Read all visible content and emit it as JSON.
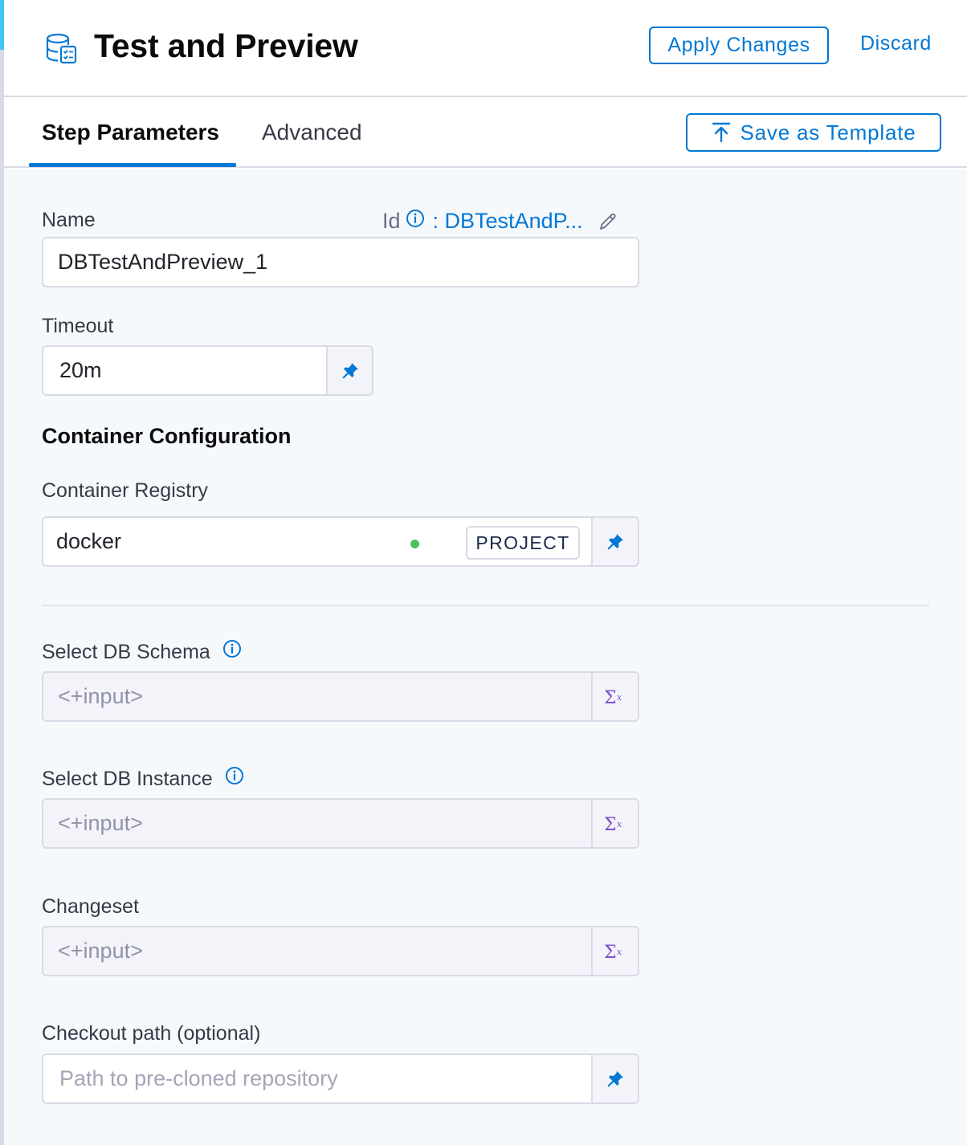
{
  "header": {
    "title": "Test and Preview",
    "apply_label": "Apply Changes",
    "discard_label": "Discard"
  },
  "tabs": {
    "step_parameters": "Step Parameters",
    "advanced": "Advanced",
    "active": "Step Parameters",
    "save_template_label": "Save as Template"
  },
  "form": {
    "name": {
      "label": "Name",
      "value": "DBTestAndPreview_1",
      "id_label": "Id",
      "id_value": ": DBTestAndP..."
    },
    "timeout": {
      "label": "Timeout",
      "value": "20m"
    },
    "container_config": {
      "title": "Container Configuration",
      "registry_label": "Container Registry",
      "registry_value": "docker",
      "scope_badge": "PROJECT"
    },
    "db_schema": {
      "label": "Select DB Schema",
      "value": "<+input>"
    },
    "db_instance": {
      "label": "Select DB Instance",
      "value": "<+input>"
    },
    "changeset": {
      "label": "Changeset",
      "value": "<+input>"
    },
    "checkout_path": {
      "label": "Checkout path (optional)",
      "placeholder": "Path to pre-cloned repository"
    }
  },
  "colors": {
    "accent": "#0278d5",
    "status_dot": "#4cbf62",
    "expression_icon": "#7b4fd1"
  },
  "icons": {
    "header": "database-check-icon",
    "pin": "pin-icon",
    "expression": "sigma-x-icon",
    "info": "info-icon",
    "edit": "pencil-icon",
    "upload": "upload-arrow-icon",
    "chevron": "chevron-down-icon"
  }
}
